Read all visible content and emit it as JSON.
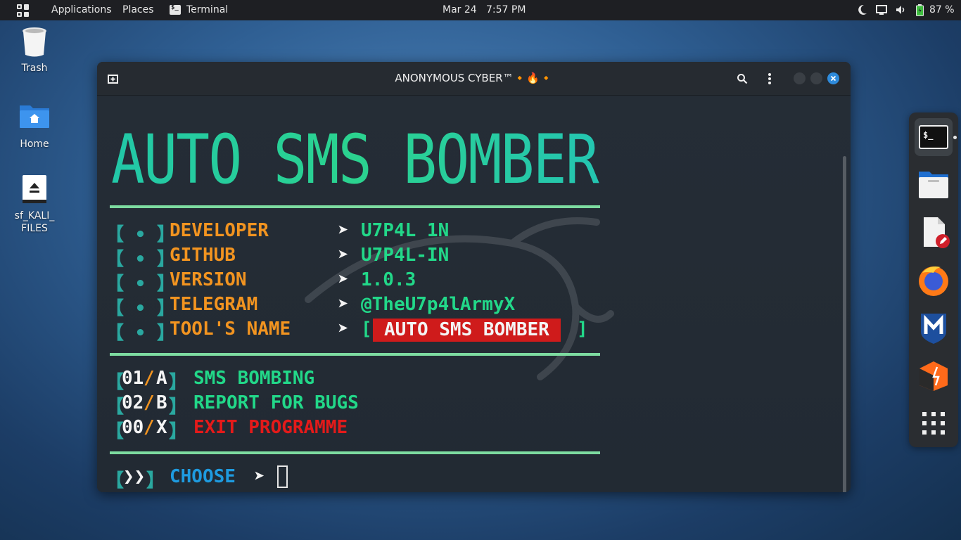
{
  "topbar": {
    "applications": "Applications",
    "places": "Places",
    "terminal": "Terminal",
    "date": "Mar 24",
    "time": "7:57 PM",
    "battery": "87 %"
  },
  "desktop": {
    "trash": "Trash",
    "home": "Home",
    "shared_folder": "sf_KALI_\nFILES"
  },
  "terminal": {
    "title": "ANONYMOUS CYBER™🔸🔥🔸",
    "banner": "AUTO SMS BOMBER",
    "info_rows": [
      {
        "marker": "【 • 】",
        "label": "DEVELOPER",
        "arrow": "➤",
        "value": "U7P4L 1N"
      },
      {
        "marker": "【 • 】",
        "label": "GITHUB",
        "arrow": "➤",
        "value": "U7P4L-IN"
      },
      {
        "marker": "【 • 】",
        "label": "VERSION",
        "arrow": "➤",
        "value": "1.0.3"
      },
      {
        "marker": "【 • 】",
        "label": "TELEGRAM",
        "arrow": "➤",
        "value": "@TheU7p4lArmyX"
      },
      {
        "marker": "【 • 】",
        "label": "TOOL'S NAME",
        "arrow": "➤",
        "value": "AUTO SMS BOMBER"
      }
    ],
    "menu": [
      {
        "num": "01",
        "slash": "/",
        "key": "A",
        "label": "SMS BOMBING"
      },
      {
        "num": "02",
        "slash": "/",
        "key": "B",
        "label": "REPORT FOR BUGS"
      },
      {
        "num": "00",
        "slash": "/",
        "key": "X",
        "label": "EXIT PROGRAMME"
      }
    ],
    "prompt_marker": "❯❯",
    "prompt_label": "CHOOSE",
    "prompt_arrow": "➤",
    "tool_name_open": "[",
    "tool_name_close": "]"
  },
  "colors": {
    "accent_green": "#22d889",
    "accent_orange": "#f29420",
    "accent_red": "#e41a1a",
    "accent_blue": "#1e9be0"
  }
}
